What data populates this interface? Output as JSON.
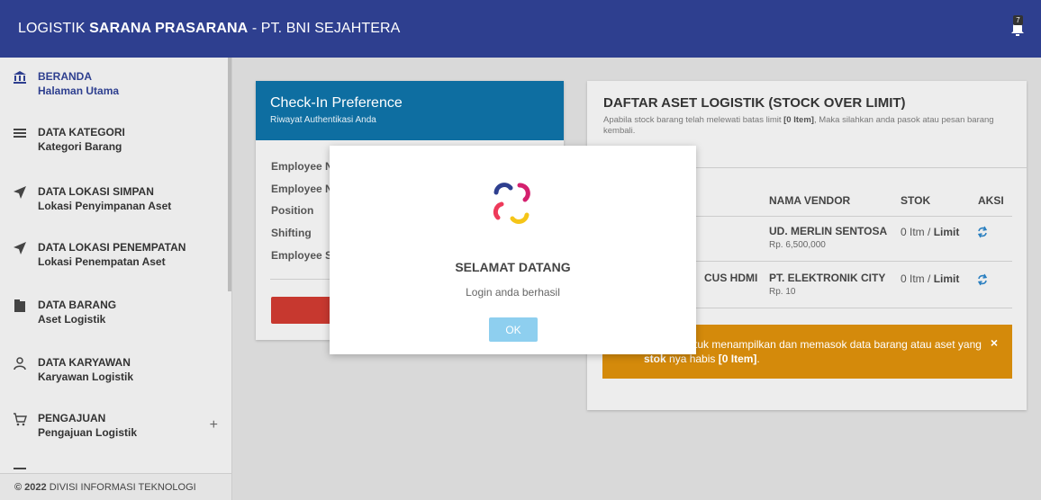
{
  "header": {
    "brand_prefix": "LOGISTIK",
    "brand_bold": "SARANA PRASARANA",
    "brand_suffix": "- PT. BNI SEJAHTERA",
    "notification_count": "7"
  },
  "sidebar": {
    "items": [
      {
        "title": "BERANDA",
        "subtitle": "Halaman Utama",
        "icon": "bank-icon"
      },
      {
        "title": "DATA KATEGORI",
        "subtitle": "Kategori Barang",
        "icon": "menu-lines-icon"
      },
      {
        "title": "DATA LOKASI SIMPAN",
        "subtitle": "Lokasi Penyimpanan Aset",
        "icon": "navigation-arrow-icon"
      },
      {
        "title": "DATA LOKASI PENEMPATAN",
        "subtitle": "Lokasi Penempatan Aset",
        "icon": "navigation-arrow-icon"
      },
      {
        "title": "DATA BARANG",
        "subtitle": "Aset Logistik",
        "icon": "box-icon"
      },
      {
        "title": "DATA KARYAWAN",
        "subtitle": "Karyawan Logistik",
        "icon": "user-icon"
      },
      {
        "title": "PENGAJUAN",
        "subtitle": "Pengajuan Logistik",
        "icon": "cart-icon",
        "expand": "+"
      }
    ],
    "footer_year": "© 2022",
    "footer_text": "DIVISI INFORMASI TEKNOLOGI"
  },
  "checkin_card": {
    "title": "Check-In Preference",
    "subtitle": "Riwayat Authentikasi Anda",
    "fields": [
      "Employee N",
      "Employee N",
      "Position",
      "Shifting",
      "Employee St"
    ]
  },
  "stock_card": {
    "title": "DAFTAR ASET LOGISTIK (STOCK OVER LIMIT)",
    "subtitle_pre": "Apabila stock barang telah melewati batas limit ",
    "subtitle_bold": "[0 Item]",
    "subtitle_post": ", Maka silahkan anda pasok atau pesan barang kembali.",
    "columns": {
      "vendor": "NAMA VENDOR",
      "stock": "STOK",
      "action": "AKSI"
    },
    "rows": [
      {
        "item": "",
        "vendor": "UD. MERLIN SENTOSA",
        "price": "Rp. 6,500,000",
        "stock_value": "0 Itm /",
        "stock_limit": "Limit"
      },
      {
        "item": "CUS HDMI",
        "vendor": "PT. ELEKTRONIK CITY",
        "price": "Rp. 10",
        "stock_value": "0 Itm /",
        "stock_limit": "Limit"
      }
    ],
    "alert_pre": "unakan untuk menampilkan dan memasok data barang atau aset yang ",
    "alert_bold1": "stok",
    "alert_mid": " nya habis ",
    "alert_bold2": "[0 Item]",
    "alert_end": ".",
    "alert_close": "×"
  },
  "modal": {
    "heading": "SELAMAT DATANG",
    "message": "Login anda berhasil",
    "ok_label": "OK"
  },
  "colors": {
    "header": "#2e3f8f",
    "card_header": "#0e6ea1",
    "alert": "#d48a0b",
    "ok_button": "#8ecfef",
    "logout_button": "#c7382f"
  }
}
